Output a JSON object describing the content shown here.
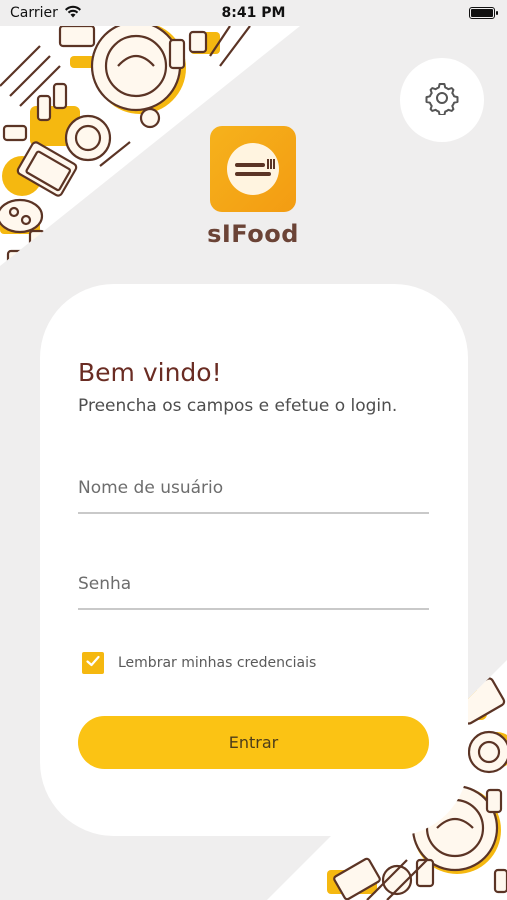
{
  "status_bar": {
    "carrier": "Carrier",
    "time": "8:41 PM"
  },
  "app": {
    "name": "sIFood"
  },
  "login": {
    "title": "Bem vindo!",
    "subtitle": "Preencha os campos e efetue o login.",
    "username_placeholder": "Nome de usuário",
    "password_placeholder": "Senha",
    "remember_label": "Lembrar minhas credenciais",
    "remember_checked": true,
    "submit_label": "Entrar"
  },
  "icons": {
    "settings": "gear-icon",
    "wifi": "wifi-icon",
    "battery": "battery-icon",
    "logo": "plate-cutlery-icon",
    "check": "check-icon"
  },
  "colors": {
    "accent": "#fbc314",
    "brand_brown": "#6b4336",
    "title": "#6a2c23",
    "background": "#efeeee"
  }
}
